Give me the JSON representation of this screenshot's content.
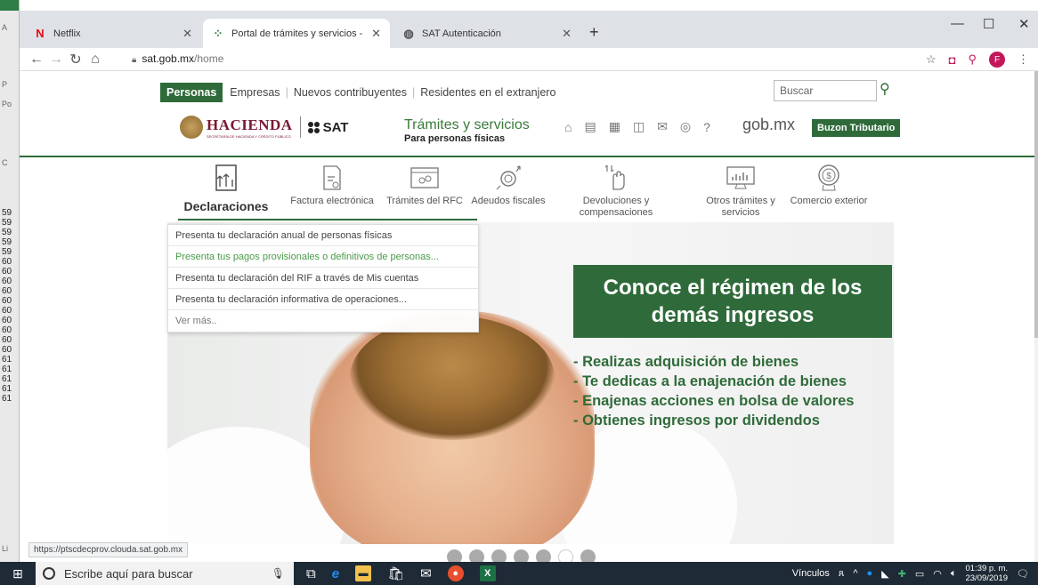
{
  "left_window": {
    "letters": [
      "A",
      "P",
      "Po",
      "C",
      "Li"
    ],
    "numbers": [
      "59",
      "59",
      "59",
      "59",
      "59",
      "60",
      "60",
      "60",
      "60",
      "60",
      "60",
      "60",
      "60",
      "60",
      "60",
      "61",
      "61",
      "61",
      "61",
      "61"
    ]
  },
  "browser": {
    "tabs": [
      {
        "icon": "netflix-icon",
        "label": "Netflix",
        "active": false
      },
      {
        "icon": "sat-icon",
        "label": "Portal de trámites y servicios - SA",
        "active": true
      },
      {
        "icon": "globe-icon",
        "label": "SAT Autenticación",
        "active": false
      }
    ],
    "url_host": "sat.gob.mx",
    "url_path": "/home",
    "profile_initial": "F"
  },
  "page": {
    "top_nav": [
      "Personas",
      "Empresas",
      "Nuevos contribuyentes",
      "Residentes en el extranjero"
    ],
    "search_placeholder": "Buscar",
    "hacienda": "HACIENDA",
    "hacienda_sub": "SECRETARÍA DE HACIENDA Y CRÉDITO PÚBLICO",
    "sat": "SAT",
    "tramites_title": "Trámites y servicios",
    "tramites_sub": "Para personas físicas",
    "gobmx": "gob.mx",
    "buzon": "Buzon Tributario",
    "menu": [
      {
        "label": "Declaraciones"
      },
      {
        "label": "Factura electrónica"
      },
      {
        "label": "Trámites del RFC"
      },
      {
        "label": "Adeudos fiscales"
      },
      {
        "label": "Devoluciones y compensaciones"
      },
      {
        "label": "Otros trámites y servicios"
      },
      {
        "label": "Comercio exterior"
      }
    ],
    "dropdown": [
      "Presenta tu declaración anual de personas físicas",
      "Presenta tus pagos provisionales o definitivos de personas...",
      "Presenta tu declaración del RIF a través de Mis cuentas",
      "Presenta tu declaración informativa de operaciones...",
      "Ver más.."
    ],
    "promo_title": "Conoce el régimen de los demás ingresos",
    "promo_bullets": [
      "- Realizas adquisición de bienes",
      "- Te dedicas a la enajenación de bienes",
      "- Enajenas acciones en bolsa de valores",
      "- Obtienes ingresos por dividendos"
    ],
    "status_url": "https://ptscdecprov.clouda.sat.gob.mx",
    "carousel_dots": 7,
    "carousel_active": 6
  },
  "taskbar": {
    "search_placeholder": "Escribe aquí para buscar",
    "vinculos": "Vínculos",
    "time": "01:39 p. m.",
    "date": "23/09/2019"
  }
}
